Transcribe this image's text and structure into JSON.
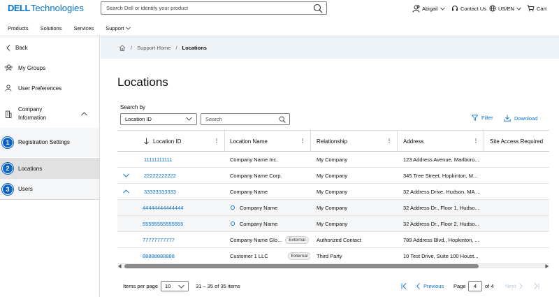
{
  "header": {
    "logo_bold": "DELL",
    "logo_rest": "Technologies",
    "search_placeholder": "Search Dell or identify your product",
    "user_name": "Abigail",
    "contact_us": "Contact Us",
    "locale": "US/EN",
    "cart": "Cart"
  },
  "nav": {
    "items": [
      "Products",
      "Solutions",
      "Services",
      "Support"
    ]
  },
  "sidebar": {
    "back": "Back",
    "my_groups": "My Groups",
    "user_preferences": "User Preferences",
    "company_info": "Company Information",
    "steps": [
      {
        "number": "1",
        "label": "Registration Settings"
      },
      {
        "number": "2",
        "label": "Locations"
      },
      {
        "number": "3",
        "label": "Users"
      }
    ]
  },
  "breadcrumb": {
    "home": "Support Home",
    "current": "Locations"
  },
  "page": {
    "title": "Locations",
    "search_by_label": "Search by",
    "search_by_value": "Location ID",
    "search_placeholder": "Search",
    "filter": "Filter",
    "download": "Download"
  },
  "table": {
    "columns": [
      "Location ID",
      "Location Name",
      "Relationship",
      "Address",
      "Site Access Required"
    ],
    "rows": [
      {
        "id": "11111111111",
        "name": "Company Name Inc.",
        "badge": "",
        "relationship": "My Company",
        "address": "123 Address Avenue, Marlboro..."
      },
      {
        "id": "22222222222",
        "name": "Company Name Corp.",
        "badge": "",
        "relationship": "My Company",
        "address": "345 Tree Street, Hopkinton, M..."
      },
      {
        "id": "33333333333",
        "name": "Company Name",
        "badge": "",
        "relationship": "My Company",
        "address": "32 Address Drive, Hudson, MA ..."
      },
      {
        "id": "44444444444444",
        "name": "Company Name",
        "badge": "",
        "relationship": "My Company",
        "address": "32 Address Dr., Floor 1, Hudso..."
      },
      {
        "id": "55555555555555",
        "name": "Company Name",
        "badge": "",
        "relationship": "My Company",
        "address": "32 Address Dr., Floor 2, Hudso..."
      },
      {
        "id": "77777777777",
        "name": "Company Name Glo...",
        "badge": "External",
        "relationship": "Authorized Contact",
        "address": "789 Address Blvd., Hopkinton, ..."
      },
      {
        "id": "88888888888",
        "name": "Customer 1 LLC",
        "badge": "External",
        "relationship": "Third Party",
        "address": "10 Test Drive, Suite 100 Houst..."
      }
    ]
  },
  "pagination": {
    "items_per_page_label": "Items per page",
    "items_per_page": "10",
    "range": "31 – 35 of 35 items",
    "previous": "Previous",
    "page_label": "Page",
    "page": "4",
    "of_total": "of 4",
    "next": "Next"
  },
  "colors": {
    "accent": "#0672cb",
    "step_badge": "#0b63c6",
    "breadcrumb_bg": "#eef3f8"
  }
}
